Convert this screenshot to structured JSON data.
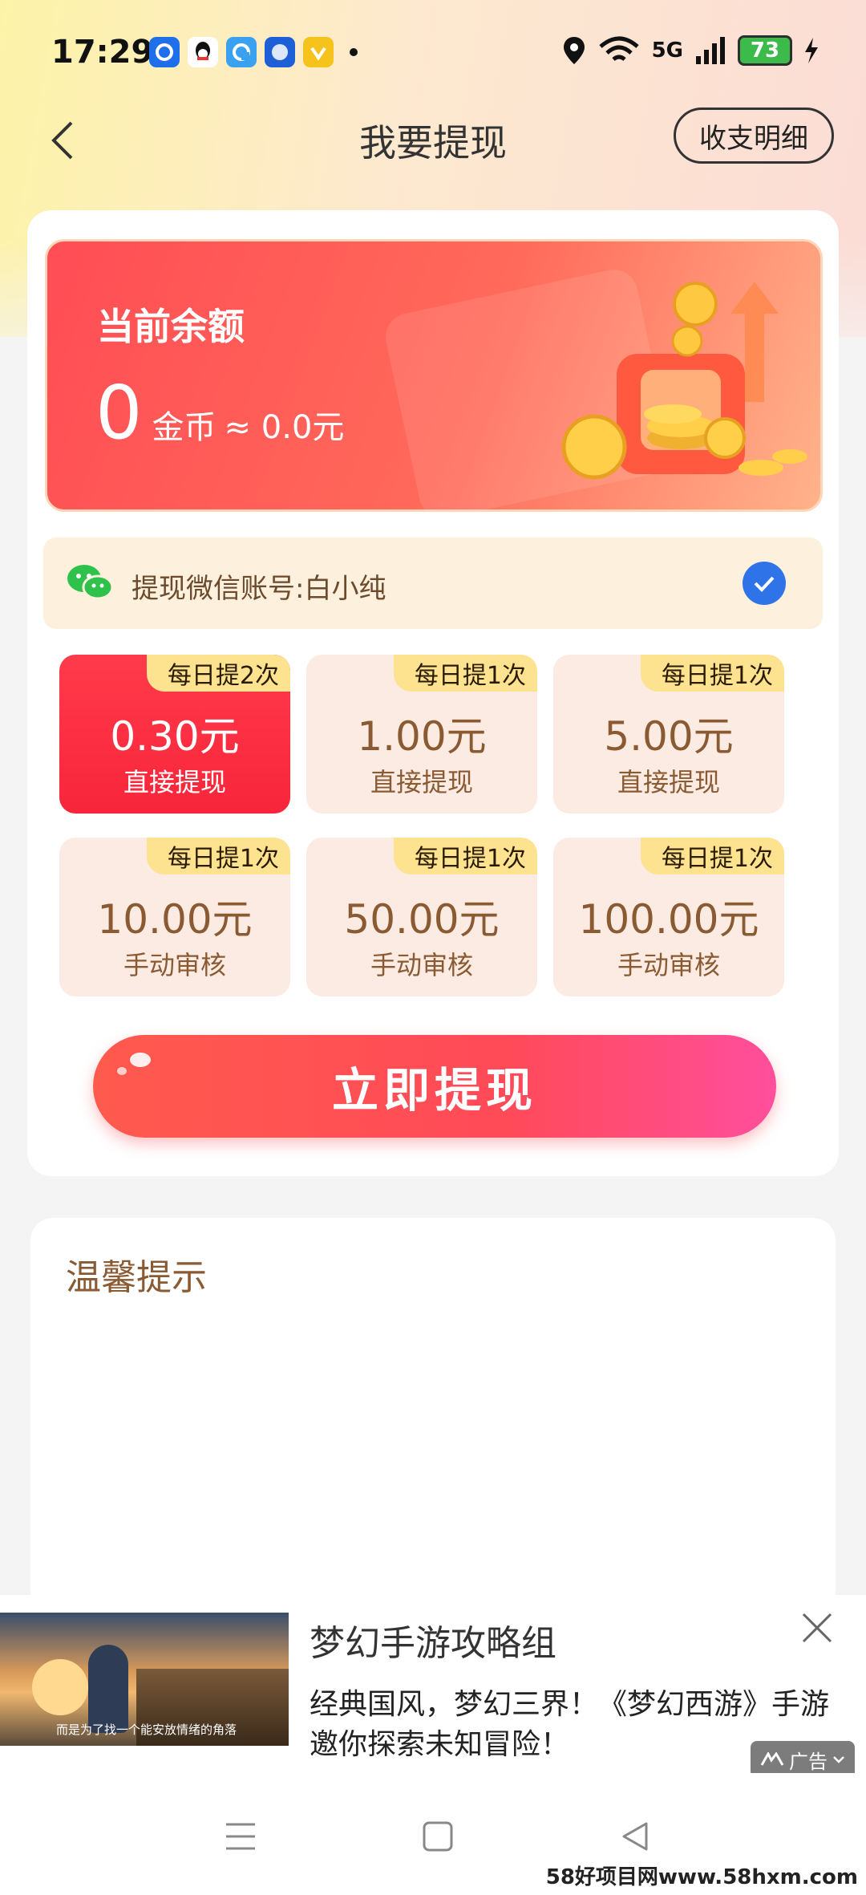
{
  "status_bar": {
    "time": "17:29",
    "network": "5G",
    "battery": "73"
  },
  "header": {
    "title": "我要提现",
    "detail_button": "收支明细"
  },
  "balance": {
    "label": "当前余额",
    "coins": "0",
    "coin_unit": "金币",
    "approx": "≈ 0.0元"
  },
  "account": {
    "label": "提现微信账号:白小纯"
  },
  "options": [
    {
      "tag": "每日提2次",
      "amount": "0.30元",
      "type": "直接提现",
      "selected": true
    },
    {
      "tag": "每日提1次",
      "amount": "1.00元",
      "type": "直接提现",
      "selected": false
    },
    {
      "tag": "每日提1次",
      "amount": "5.00元",
      "type": "直接提现",
      "selected": false
    },
    {
      "tag": "每日提1次",
      "amount": "10.00元",
      "type": "手动审核",
      "selected": false
    },
    {
      "tag": "每日提1次",
      "amount": "50.00元",
      "type": "手动审核",
      "selected": false
    },
    {
      "tag": "每日提1次",
      "amount": "100.00元",
      "type": "手动审核",
      "selected": false
    }
  ],
  "withdraw_button": "立即提现",
  "tips": {
    "title": "温馨提示"
  },
  "ad": {
    "image_caption": "而是为了找一个能安放情绪的角落",
    "title": "梦幻手游攻略组",
    "description": "经典国风，梦幻三界！《梦幻西游》手游邀你探索未知冒险！",
    "badge": "广告"
  },
  "watermark": "58好项目网www.58hxm.com",
  "colors": {
    "accent_red": "#f8253a",
    "option_bg": "#fcebe2",
    "tag_yellow": "#fde38f",
    "brown_text": "#8a5a33",
    "check_blue": "#2f73e8"
  }
}
